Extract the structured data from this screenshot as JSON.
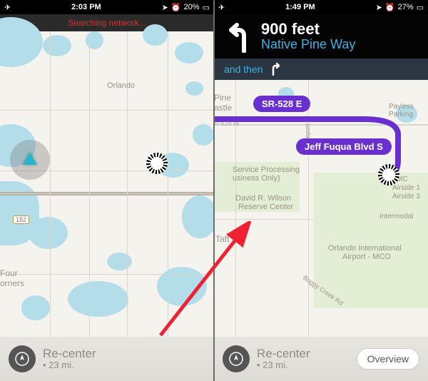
{
  "left": {
    "status": {
      "time": "2:03 PM",
      "battery": "20%",
      "net": "Searching network..."
    },
    "labels": {
      "orlando": "Orlando",
      "four": "Four",
      "corners": "orners",
      "hwy": "182"
    },
    "recenter": {
      "title": "Re-center",
      "sub": "• 23 mi."
    }
  },
  "right": {
    "status": {
      "time": "1:49 PM",
      "battery": "27%"
    },
    "nav": {
      "dist": "900 feet",
      "street": "Native Pine Way",
      "andthen": "and then"
    },
    "labels": {
      "pine": "Pine",
      "astle": "astle",
      "sr528w": "R-528 W",
      "payless": "Payless",
      "parking": "Parking",
      "svc": "Service Processing",
      "biz": "usiness Only)",
      "david": "David R. Wilson",
      "reserve": "Reserve Center",
      "taft": "Taft",
      "mco": "Orlando International",
      "airport": "Airport - MCO",
      "inter": "Intermodal",
      "airside1": "Airside 1",
      "airside3": "Airside 3",
      "mc": "MC",
      "trade": "Tradeport Dr",
      "boggy": "Boggy Creek Rd"
    },
    "bubbles": {
      "sr": "SR-528 E",
      "jeff": "Jeff Fuqua Blvd S"
    },
    "recenter": {
      "title": "Re-center",
      "sub": "• 23 mi."
    },
    "overview": "Overview"
  }
}
